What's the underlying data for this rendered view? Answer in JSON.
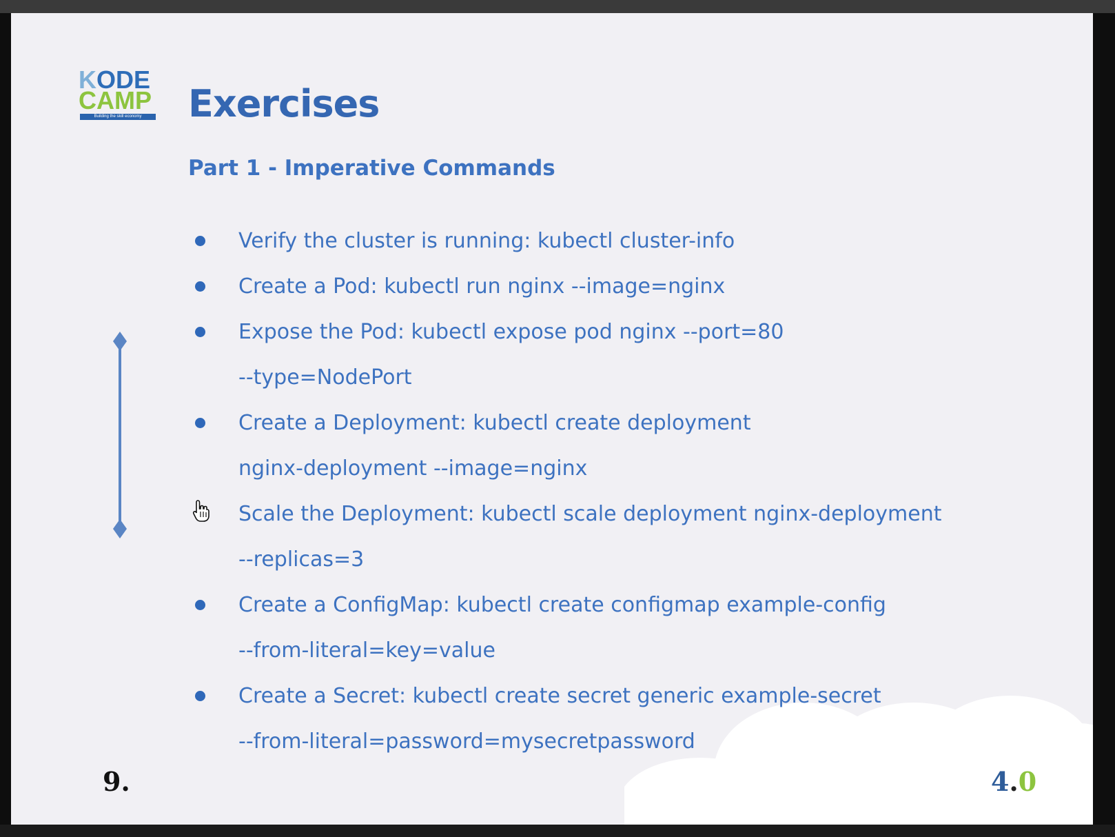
{
  "logo": {
    "line1_k": "K",
    "line1_rest": "ODE",
    "line2": "CAMP",
    "tagline": "Building the skill economy"
  },
  "slide": {
    "title": "Exercises",
    "subtitle": "Part 1 - Imperative Commands",
    "items": [
      {
        "line1": "Verify the cluster is running: kubectl cluster-info",
        "line2": ""
      },
      {
        "line1": "Create a Pod: kubectl run nginx --image=nginx",
        "line2": ""
      },
      {
        "line1": "Expose the Pod: kubectl expose pod nginx --port=80",
        "line2": "--type=NodePort"
      },
      {
        "line1": "Create a Deployment: kubectl create deployment",
        "line2": "nginx-deployment --image=nginx"
      },
      {
        "line1": "Scale the Deployment: kubectl scale deployment nginx-deployment",
        "line2": "--replicas=3"
      },
      {
        "line1": "Create a ConfigMap: kubectl create configmap example-config",
        "line2": "--from-literal=key=value"
      },
      {
        "line1": "Create a Secret: kubectl create secret generic example-secret",
        "line2": "--from-literal=password=mysecretpassword"
      }
    ],
    "slide_number": "9.",
    "version": {
      "major": "4",
      "dot": ".",
      "minor": "0"
    }
  },
  "colors": {
    "title": "#3567b2",
    "text": "#3d72c0",
    "bullet": "#2f68b9",
    "accent_green": "#8dc43f",
    "background": "#f1f0f4"
  },
  "icons": {
    "scroll_indicator": "vertical-scroll-indicator-icon",
    "cursor": "hand-pointer-cursor-icon"
  }
}
